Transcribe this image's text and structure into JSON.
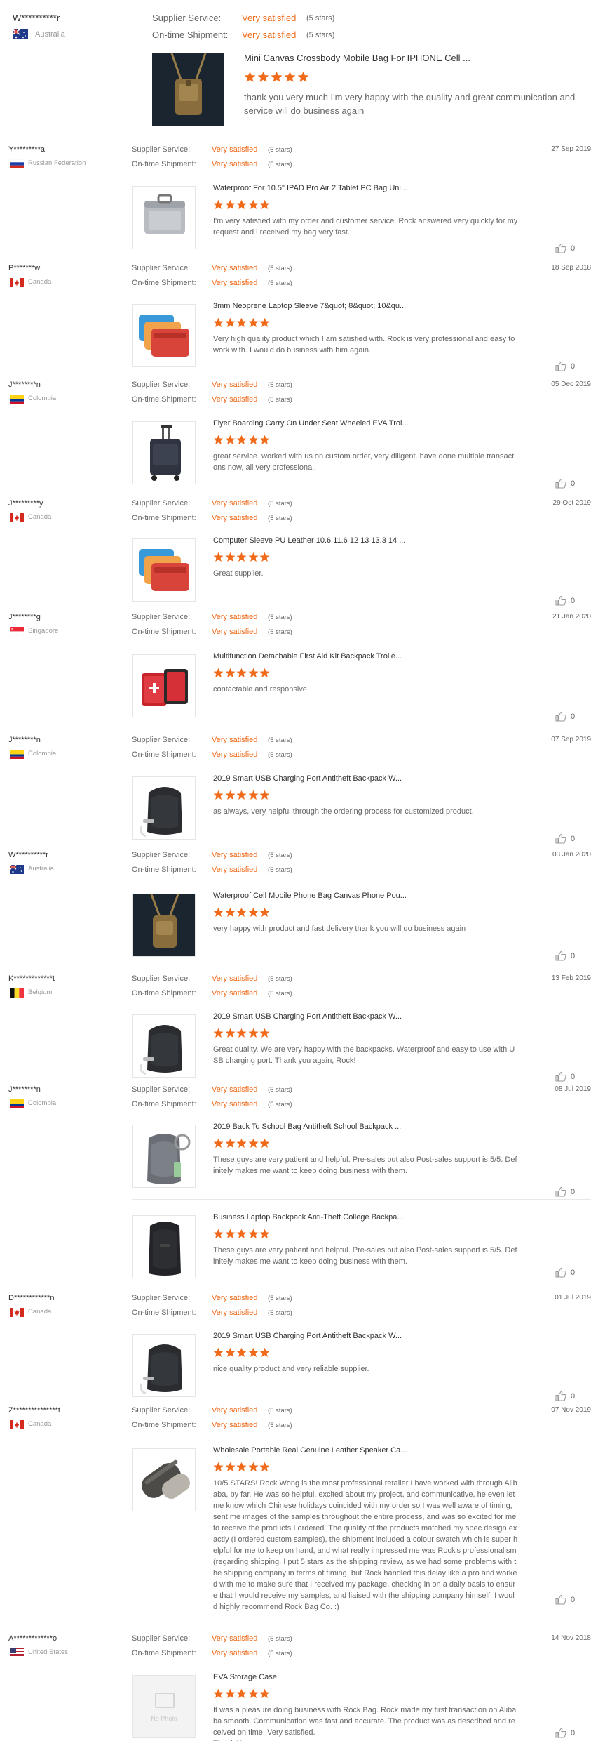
{
  "colors": {
    "accent": "#f06a1a",
    "star": "#f06a1a",
    "muted": "#999999"
  },
  "labels": {
    "supplier_service": "Supplier Service:",
    "ontime_shipment": "On-time Shipment:",
    "very_satisfied": "Very satisfied",
    "five_stars": "(5 stars)"
  },
  "top_review": {
    "username": "W**********r",
    "country": "Australia",
    "flag": "australia-flag",
    "product": "Mini Canvas Crossbody Mobile Bag For IPHONE Cell ...",
    "rating": 5,
    "comment": "thank you very much I'm very happy with the quality and great communication and service will do business again"
  },
  "reviews": [
    {
      "username": "Y*********a",
      "country": "Russian Federation",
      "flag": "russia-flag",
      "date": "27 Sep 2019",
      "items": [
        {
          "product": "Waterproof For 10.5\" IPAD Pro Air 2 Tablet PC Bag Uni...",
          "rating": 5,
          "comment": "I'm very satisfied with my order and customer service. Rock answered very quickly for my request and i received my bag very fast.",
          "likes": "0",
          "image": "gray-laptop-bag"
        }
      ]
    },
    {
      "username": "P*******w",
      "country": "Canada",
      "flag": "canada-flag",
      "date": "18 Sep 2018",
      "items": [
        {
          "product": "3mm Neoprene Laptop Sleeve 7&quot; 8&quot; 10&qu...",
          "rating": 5,
          "comment": "Very high quality product which I am satisfied with. Rock is very professional and easy to work with. I would do business with him again.",
          "likes": "0",
          "image": "neoprene-sleeves"
        }
      ]
    },
    {
      "username": "J********n",
      "country": "Colombia",
      "flag": "colombia-flag",
      "date": "05 Dec 2019",
      "items": [
        {
          "product": "Flyer Boarding Carry On Under Seat Wheeled EVA Trol...",
          "rating": 5,
          "comment": "great service. worked with us on custom order, very diligent. have done multiple transactions now, all very professional.",
          "likes": "0",
          "image": "wheeled-trolley"
        }
      ]
    },
    {
      "username": "J*********y",
      "country": "Canada",
      "flag": "canada-flag",
      "date": "29 Oct 2019",
      "items": [
        {
          "product": "Computer Sleeve PU Leather 10.6 11.6 12 13 13.3 14 ...",
          "rating": 5,
          "comment": "Great supplier.",
          "likes": "0",
          "image": "neoprene-sleeves"
        }
      ]
    },
    {
      "username": "J********g",
      "country": "Singapore",
      "flag": "singapore-flag",
      "date": "21 Jan 2020",
      "items": [
        {
          "product": "Multifunction Detachable First Aid Kit Backpack Trolle...",
          "rating": 5,
          "comment": "contactable and responsive",
          "likes": "0",
          "image": "first-aid-backpack"
        }
      ]
    },
    {
      "username": "J********n",
      "country": "Colombia",
      "flag": "colombia-flag",
      "date": "07 Sep 2019",
      "items": [
        {
          "product": "2019 Smart USB Charging Port Antitheft Backpack W...",
          "rating": 5,
          "comment": "as always, very helpful through the ordering process for customized product.",
          "likes": "0",
          "image": "black-backpack"
        }
      ]
    },
    {
      "username": "W**********r",
      "country": "Australia",
      "flag": "australia-flag",
      "date": "03 Jan 2020",
      "items": [
        {
          "product": "Waterproof Cell Mobile Phone Bag Canvas Phone Pou...",
          "rating": 5,
          "comment": "very happy with product and fast delivery thank you will do business again",
          "likes": "0",
          "image": "canvas-pouch"
        }
      ]
    },
    {
      "username": "K*************t",
      "country": "Belgium",
      "flag": "belgium-flag",
      "date": "13 Feb 2019",
      "items": [
        {
          "product": "2019 Smart USB Charging Port Antitheft Backpack W...",
          "rating": 5,
          "comment": "Great quality. We are very happy with the backpacks. Waterproof and easy to use with USB charging port. Thank you again, Rock!",
          "likes": "0",
          "image": "black-backpack"
        }
      ]
    },
    {
      "username": "J********n",
      "country": "Colombia",
      "flag": "colombia-flag",
      "date": "08 Jul 2019",
      "items": [
        {
          "product": "2019 Back To School Bag Antitheft School Backpack ...",
          "rating": 5,
          "comment": "These guys are very patient and helpful. Pre-sales but also Post-sales support is 5/5. Definitely makes me want to keep doing business with them.",
          "likes": "0",
          "image": "gray-backpack"
        },
        {
          "product": "Business Laptop Backpack Anti-Theft College Backpa...",
          "rating": 5,
          "comment": "These guys are very patient and helpful. Pre-sales but also Post-sales support is 5/5. Definitely makes me want to keep doing business with them.",
          "likes": "0",
          "image": "black-backpack-plain"
        }
      ]
    },
    {
      "username": "D************n",
      "country": "Canada",
      "flag": "canada-flag",
      "date": "01 Jul 2019",
      "items": [
        {
          "product": "2019 Smart USB Charging Port Antitheft Backpack W...",
          "rating": 5,
          "comment": "nice quality product and very reliable supplier.",
          "likes": "0",
          "image": "black-backpack"
        }
      ]
    },
    {
      "username": "Z***************t",
      "country": "Canada",
      "flag": "canada-flag",
      "date": "07 Nov 2019",
      "items": [
        {
          "product": "Wholesale Portable Real Genuine Leather Speaker Ca...",
          "rating": 5,
          "comment": "10/5 STARS! Rock Wong is the most professional retailer I have worked with through Alibaba, by far. He was so helpful, excited about my project, and communicative, he even let me know which Chinese holidays coincided with my order so I was well aware of timing, sent me images of the samples throughout the entire process, and was so excited for me to receive the products I ordered. The quality of the products matched my spec design exactly (I ordered custom samples), the shipment included a colour swatch which is super helpful for me to keep on hand, and what really impressed me was Rock's professionalism (regarding shipping. I put 5 stars as the shipping review, as we had some problems with the shipping company in terms of timing, but Rock handled this delay like a pro and worked with me to make sure that I received my package, checking in on a daily basis to ensure that I would receive my samples, and liaised with the shipping company himself. I would highly recommend Rock Bag Co. :)",
          "likes": "0",
          "image": "speaker-case"
        }
      ]
    },
    {
      "username": "A*************o",
      "country": "United States",
      "flag": "usa-flag",
      "date": "14 Nov 2018",
      "items": [
        {
          "product": "EVA Storage Case",
          "rating": 5,
          "comment": "It was a pleasure doing business with Rock Bag. Rock made my first transaction on Alibaba smooth. Communication was fast and accurate. The product was as described and received on time.  Very satisfied.\nThank You",
          "likes": "0",
          "image": "no-photo",
          "no_photo_label": "No Photo"
        }
      ]
    }
  ]
}
